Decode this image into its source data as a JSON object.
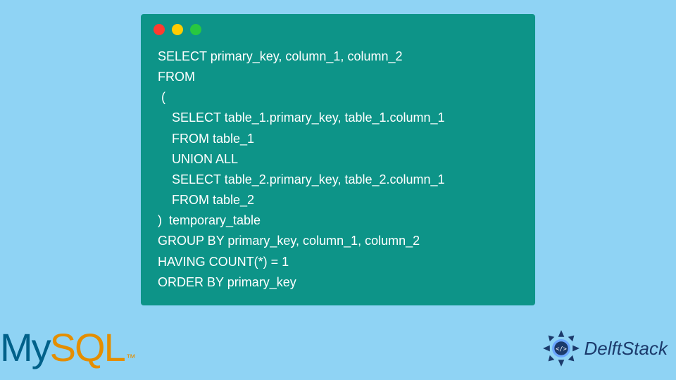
{
  "code": {
    "lines": [
      "SELECT primary_key, column_1, column_2",
      "FROM",
      " (",
      "    SELECT table_1.primary_key, table_1.column_1",
      "    FROM table_1",
      "    UNION ALL",
      "    SELECT table_2.primary_key, table_2.column_1",
      "    FROM table_2",
      ")  temporary_table",
      "GROUP BY primary_key, column_1, column_2",
      "HAVING COUNT(*) = 1",
      "ORDER BY primary_key"
    ]
  },
  "logos": {
    "mysql_my": "My",
    "mysql_sql": "SQL",
    "mysql_tm": "™",
    "delftstack": "DelftStack"
  },
  "window": {
    "dots": [
      "red",
      "yellow",
      "green"
    ]
  }
}
